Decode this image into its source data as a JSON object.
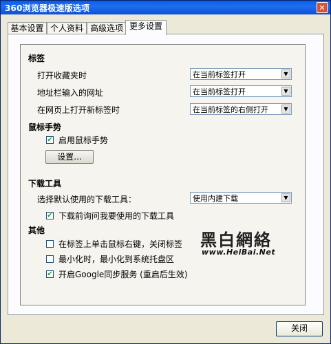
{
  "window": {
    "title": "360浏览器极速版选项",
    "close_glyph": "✕"
  },
  "tabs": [
    {
      "label": "基本设置"
    },
    {
      "label": "个人资料"
    },
    {
      "label": "高级选项"
    },
    {
      "label": "更多设置",
      "active": true
    }
  ],
  "tabs_section": {
    "heading": "标签",
    "rows": [
      {
        "label": "打开收藏夹时",
        "value": "在当前标签打开"
      },
      {
        "label": "地址栏输入的网址",
        "value": "在当前标签打开"
      },
      {
        "label": "在网页上打开新标签时",
        "value": "在当前标签的右侧打开"
      }
    ]
  },
  "gesture_section": {
    "heading": "鼠标手势",
    "enable_label": "启用鼠标手势",
    "enable_checked": true,
    "settings_button": "设置..."
  },
  "download_section": {
    "heading": "下载工具",
    "default_label": "选择默认使用的下载工具：",
    "default_value": "使用内建下载",
    "ask_label": "下载前询问我要使用的下载工具",
    "ask_checked": true
  },
  "other_section": {
    "heading": "其他",
    "items": [
      {
        "label": "在标签上单击鼠标右键，关闭标签",
        "checked": false
      },
      {
        "label": "最小化时，最小化到系统托盘区",
        "checked": false
      },
      {
        "label": "开启Google同步服务 (重启后生效)",
        "checked": true
      }
    ]
  },
  "watermark": {
    "text": "黑白網絡",
    "url": "www.HeiBai.Net"
  },
  "footer": {
    "close_label": "关闭"
  },
  "icons": {
    "dropdown": "▼",
    "check": "✔"
  }
}
